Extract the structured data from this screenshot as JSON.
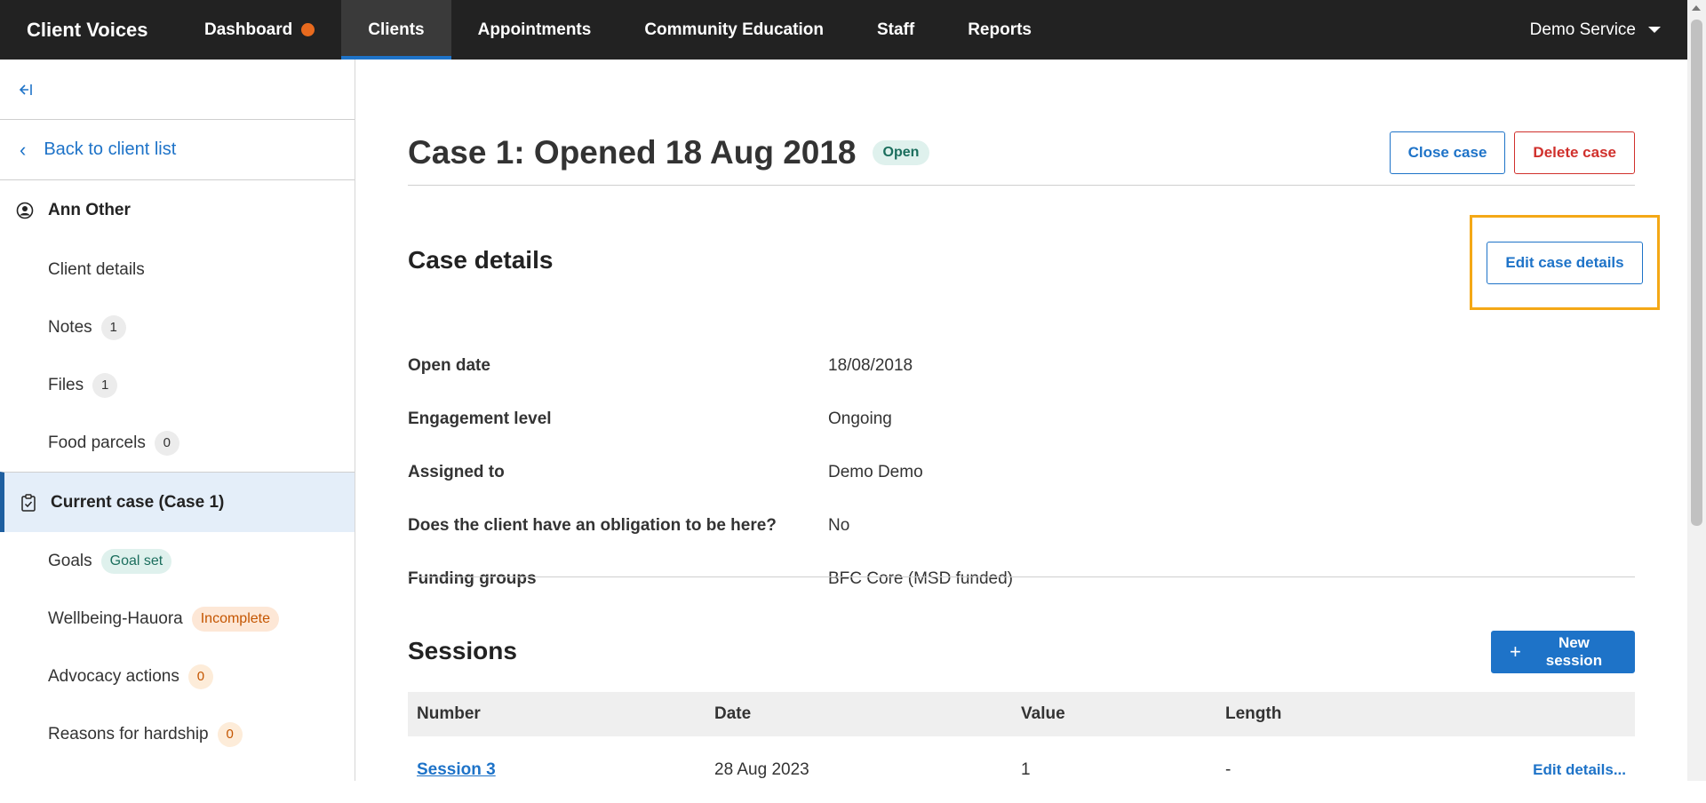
{
  "nav": {
    "brand": "Client Voices",
    "items": [
      {
        "label": "Dashboard"
      },
      {
        "label": "Clients"
      },
      {
        "label": "Appointments"
      },
      {
        "label": "Community Education"
      },
      {
        "label": "Staff"
      },
      {
        "label": "Reports"
      }
    ],
    "service": "Demo Service",
    "active": "Clients",
    "notification_color": "#e86a1e"
  },
  "sidebar": {
    "collapse_icon": "collapse-left-icon",
    "back_label": "Back to client list",
    "client_name": "Ann Other",
    "client_items": [
      {
        "label": "Client details"
      },
      {
        "label": "Notes",
        "count": "1"
      },
      {
        "label": "Files",
        "count": "1"
      },
      {
        "label": "Food parcels",
        "count": "0"
      }
    ],
    "current_case": "Current case (Case 1)",
    "case_items": [
      {
        "label": "Goals",
        "tag": "Goal set"
      },
      {
        "label": "Wellbeing-Hauora",
        "tag": "Incomplete"
      },
      {
        "label": "Advocacy actions",
        "count": "0"
      },
      {
        "label": "Reasons for hardship",
        "count": "0"
      }
    ]
  },
  "case": {
    "title": "Case 1: Opened 18 Aug 2018",
    "status": "Open",
    "close_label": "Close case",
    "delete_label": "Delete case"
  },
  "details": {
    "heading": "Case details",
    "edit_label": "Edit case details",
    "rows": [
      {
        "label": "Open date",
        "value": "18/08/2018"
      },
      {
        "label": "Engagement level",
        "value": "Ongoing"
      },
      {
        "label": "Assigned to",
        "value": "Demo Demo"
      },
      {
        "label": "Does the client have an obligation to be here?",
        "value": "No"
      },
      {
        "label": "Funding groups",
        "value": "BFC Core (MSD funded)"
      }
    ]
  },
  "sessions": {
    "heading": "Sessions",
    "new_label": "New session",
    "columns": [
      "Number",
      "Date",
      "Value",
      "Length"
    ],
    "rows": [
      {
        "number": "Session 3",
        "date": "28 Aug 2023",
        "value": "1",
        "length": "-",
        "action": "Edit details..."
      }
    ]
  },
  "colors": {
    "accent": "#1e73c8",
    "danger": "#d0302c",
    "highlight": "#f4a816",
    "nav_bg": "#222222"
  }
}
